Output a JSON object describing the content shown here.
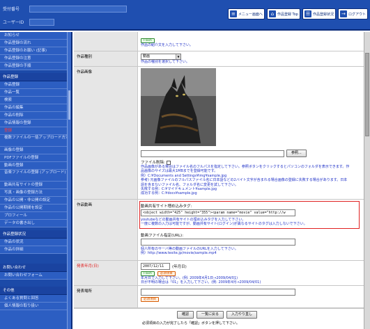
{
  "header": {
    "field1_label": "受付番号",
    "field1_value": "",
    "field2_label": "ユーザーID",
    "field2_value": "",
    "buttons": [
      {
        "label": "メニュー画面へ",
        "icon": "menu-icon"
      },
      {
        "label": "作品登録 Top",
        "icon": "home-icon"
      },
      {
        "label": "作品登録状況",
        "icon": "list-icon"
      },
      {
        "label": "ログアウト",
        "icon": "logout-icon"
      }
    ]
  },
  "sidebar": {
    "group1": [
      "お知らせ",
      "作品登録の流れ",
      "作品登録のお願い (記事)",
      "作品登録の注意",
      "作品登録の手順"
    ],
    "group1_head": "作品登録",
    "group2": [
      "作品登録",
      "作品一覧",
      "検索",
      "作品の編集",
      "作品の削除",
      "作品情報の登録",
      "登録"
    ],
    "group2_active_index": 6,
    "group3": [
      "複数ファイルの一括アップロード方法",
      "画像の登録",
      "PDFファイルの登録",
      "動画の登録",
      "音楽ファイルの登録 (アップロード)",
      "動画共有サイトの登録",
      "写真・画像の登録方法",
      "作品の公開・非公開の設定",
      "作品の公開期間を設定",
      "プロフィール",
      "データの書き出し"
    ],
    "group4_head": "作品登録状況",
    "group4": [
      "作品の状況",
      "作品の詳細"
    ],
    "group5_head": "お問い合わせ",
    "group5": [
      "お問い合わせフォーム"
    ],
    "group6_head": "その他",
    "group6": [
      "よくある質問と回答",
      "個人情報の取り扱い"
    ]
  },
  "form": {
    "top_badge": "Flash",
    "top_hint": "作品の紹介文を入力して下さい。",
    "work_type": {
      "label": "作品種別",
      "value": "動画",
      "hint": "作品の種別を選択して下さい。"
    },
    "work_image": {
      "label": "作品画像",
      "browse_button": "参照...",
      "file_label": "ファイル削除:",
      "hints": [
        "作品画像がある場合はファイル名のフルパスを指定して下さい。参照ボタンをクリックするとパソコンのフォルダを表示できます。作品画像のサイズは最大1MBまでを登録可能です。",
        "例）C:¥Documents and Settings¥img¥sample.jpg",
        "参考) 元画像ファイルのフルパスファイル名に日本語などの2バイト文字が含まれる場合画像の登録に失敗する場合があります。日本語を含まないファイル名、フォルダ名に変更を試して下さい。",
        "失敗する例：C:¥マイドキュメント¥sample.jpg",
        "成功する例：C:¥docs¥sample.jpg"
      ]
    },
    "video": {
      "label": "作品動画",
      "embed_label": "動画共有サイト埋め込みタグ:",
      "embed_value": "<object width=\"425\" height=\"355\"><param name=\"movie\" value=\"http://w",
      "hints": [
        "youtubeなどの動画共有サイトの埋め込みタグを入力して下さい。",
        "一度に複数の入力は可能ですが、動画共有サイト(ログイン)が異なるサイトのタグは入力しないで下さい。"
      ],
      "url_label": "動画ファイル指定(URL):",
      "url_value": "",
      "url_hints": [
        "個人所有のサーバ等の動画ファイルのURLを入力して下さい。",
        "例）http://www.tesite.jp/movie/sample.mp4"
      ]
    },
    "date": {
      "label": "発表年月(日)",
      "value": "2007/12/11",
      "unit": "(年月日)",
      "badge1": "Flash",
      "badge2": "必須項目",
      "hints": [
        "年月日で入力して下さい。(例: 2009年4月1日→2009/04/01)",
        "日が不明の場合は「01」を入力して下さい。(例: 2009年4月→2009/04/01)"
      ]
    },
    "place": {
      "label": "発表場所",
      "value": "",
      "badge": "必須項目"
    },
    "actions": {
      "confirm": "確認",
      "back": "一覧に戻る",
      "reset": "入力やり直し",
      "notice": "必須項目の入力が完了したら「確認」ボタンを押して下さい。"
    }
  }
}
